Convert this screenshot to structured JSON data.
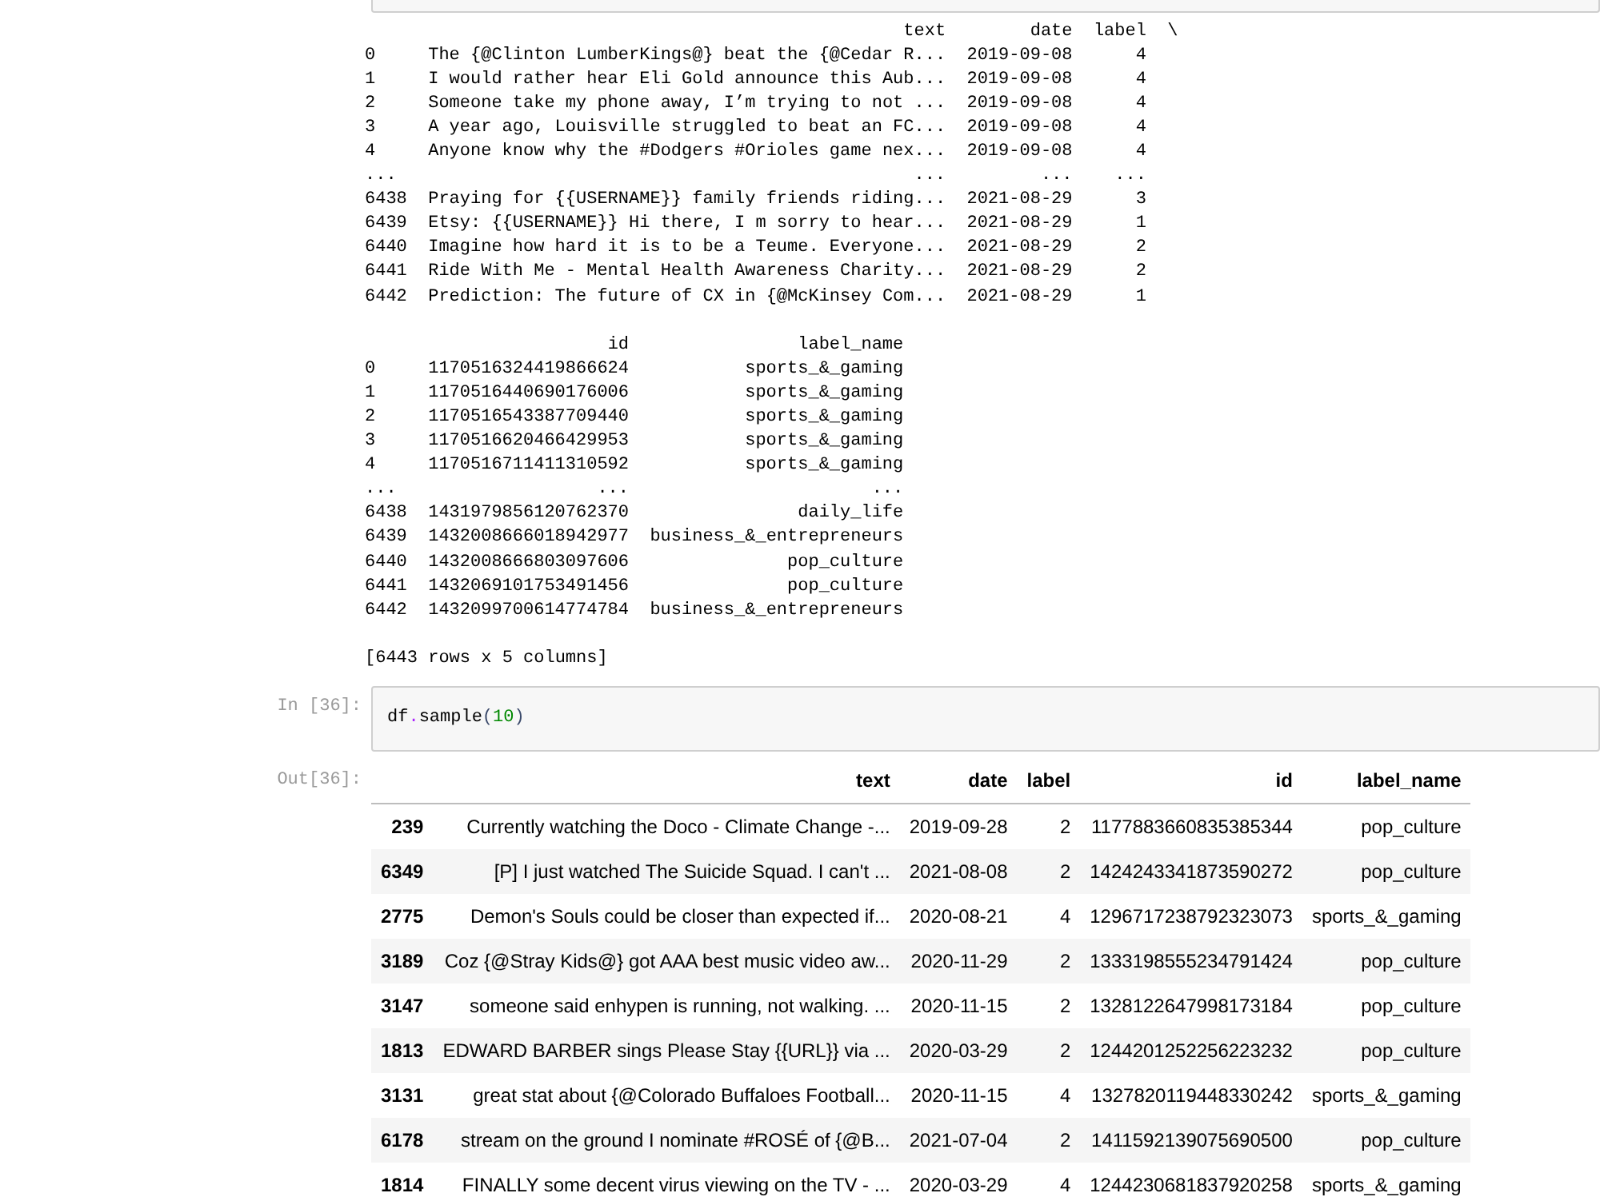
{
  "cells": [
    {
      "kind": "cut_input"
    },
    {
      "kind": "text_output",
      "frames": [
        {
          "columns": [
            "text",
            "date",
            "label"
          ],
          "continuation": "\\",
          "rows": [
            {
              "index": "0",
              "values": [
                "The {@Clinton LumberKings@} beat the {@Cedar R...",
                "2019-09-08",
                "4"
              ]
            },
            {
              "index": "1",
              "values": [
                "I would rather hear Eli Gold announce this Aub...",
                "2019-09-08",
                "4"
              ]
            },
            {
              "index": "2",
              "values": [
                "Someone take my phone away, I’m trying to not ...",
                "2019-09-08",
                "4"
              ]
            },
            {
              "index": "3",
              "values": [
                "A year ago, Louisville struggled to beat an FC...",
                "2019-09-08",
                "4"
              ]
            },
            {
              "index": "4",
              "values": [
                "Anyone know why the #Dodgers #Orioles game nex...",
                "2019-09-08",
                "4"
              ]
            },
            {
              "index": "...",
              "values": [
                "...",
                "...",
                "..."
              ]
            },
            {
              "index": "6438",
              "values": [
                "Praying for {{USERNAME}} family friends riding...",
                "2021-08-29",
                "3"
              ]
            },
            {
              "index": "6439",
              "values": [
                "Etsy: {{USERNAME}} Hi there, I m sorry to hear...",
                "2021-08-29",
                "1"
              ]
            },
            {
              "index": "6440",
              "values": [
                "Imagine how hard it is to be a Teume. Everyone...",
                "2021-08-29",
                "2"
              ]
            },
            {
              "index": "6441",
              "values": [
                "Ride With Me - Mental Health Awareness Charity...",
                "2021-08-29",
                "2"
              ]
            },
            {
              "index": "6442",
              "values": [
                "Prediction: The future of CX in {@McKinsey Com...",
                "2021-08-29",
                "1"
              ]
            }
          ]
        },
        {
          "columns": [
            "id",
            "label_name"
          ],
          "rows": [
            {
              "index": "0",
              "values": [
                "1170516324419866624",
                "sports_&_gaming"
              ]
            },
            {
              "index": "1",
              "values": [
                "1170516440690176006",
                "sports_&_gaming"
              ]
            },
            {
              "index": "2",
              "values": [
                "1170516543387709440",
                "sports_&_gaming"
              ]
            },
            {
              "index": "3",
              "values": [
                "1170516620466429953",
                "sports_&_gaming"
              ]
            },
            {
              "index": "4",
              "values": [
                "1170516711411310592",
                "sports_&_gaming"
              ]
            },
            {
              "index": "...",
              "values": [
                "...",
                "..."
              ]
            },
            {
              "index": "6438",
              "values": [
                "1431979856120762370",
                "daily_life"
              ]
            },
            {
              "index": "6439",
              "values": [
                "1432008666018942977",
                "business_&_entrepreneurs"
              ]
            },
            {
              "index": "6440",
              "values": [
                "1432008666803097606",
                "pop_culture"
              ]
            },
            {
              "index": "6441",
              "values": [
                "1432069101753491456",
                "pop_culture"
              ]
            },
            {
              "index": "6442",
              "values": [
                "1432099700614774784",
                "business_&_entrepreneurs"
              ]
            }
          ]
        }
      ],
      "summary": "[6443 rows x 5 columns]"
    },
    {
      "kind": "input",
      "prompt": "In [36]:",
      "code": [
        {
          "kind": "name",
          "text": "df"
        },
        {
          "kind": "operator",
          "text": "."
        },
        {
          "kind": "name",
          "text": "sample"
        },
        {
          "kind": "bracket",
          "text": "("
        },
        {
          "kind": "number",
          "text": "10"
        },
        {
          "kind": "bracket",
          "text": ")"
        }
      ]
    },
    {
      "kind": "html_output",
      "prompt": "Out[36]:",
      "table": {
        "columns": [
          "text",
          "date",
          "label",
          "id",
          "label_name"
        ],
        "rows": [
          {
            "index": "239",
            "values": [
              "Currently watching the Doco - Climate Change -...",
              "2019-09-28",
              "2",
              "1177883660835385344",
              "pop_culture"
            ]
          },
          {
            "index": "6349",
            "values": [
              "[P] I just watched The Suicide Squad. I can't ...",
              "2021-08-08",
              "2",
              "1424243341873590272",
              "pop_culture"
            ]
          },
          {
            "index": "2775",
            "values": [
              "Demon's Souls could be closer than expected if...",
              "2020-08-21",
              "4",
              "1296717238792323073",
              "sports_&_gaming"
            ]
          },
          {
            "index": "3189",
            "values": [
              "Coz {@Stray Kids@} got AAA best music video aw...",
              "2020-11-29",
              "2",
              "1333198555234791424",
              "pop_culture"
            ]
          },
          {
            "index": "3147",
            "values": [
              "someone said enhypen is running, not walking. ...",
              "2020-11-15",
              "2",
              "1328122647998173184",
              "pop_culture"
            ]
          },
          {
            "index": "1813",
            "values": [
              "EDWARD BARBER sings Please Stay {{URL}} via ...",
              "2020-03-29",
              "2",
              "1244201252256223232",
              "pop_culture"
            ]
          },
          {
            "index": "3131",
            "values": [
              "great stat about {@Colorado Buffaloes Football...",
              "2020-11-15",
              "4",
              "1327820119448330242",
              "sports_&_gaming"
            ]
          },
          {
            "index": "6178",
            "values": [
              "stream on the ground I nominate #ROSÉ of {@B...",
              "2021-07-04",
              "2",
              "1411592139075690500",
              "pop_culture"
            ]
          },
          {
            "index": "1814",
            "values": [
              "FINALLY some decent virus viewing on the TV - ...",
              "2020-03-29",
              "4",
              "1244230681837920258",
              "sports_&_gaming"
            ]
          }
        ]
      }
    }
  ]
}
